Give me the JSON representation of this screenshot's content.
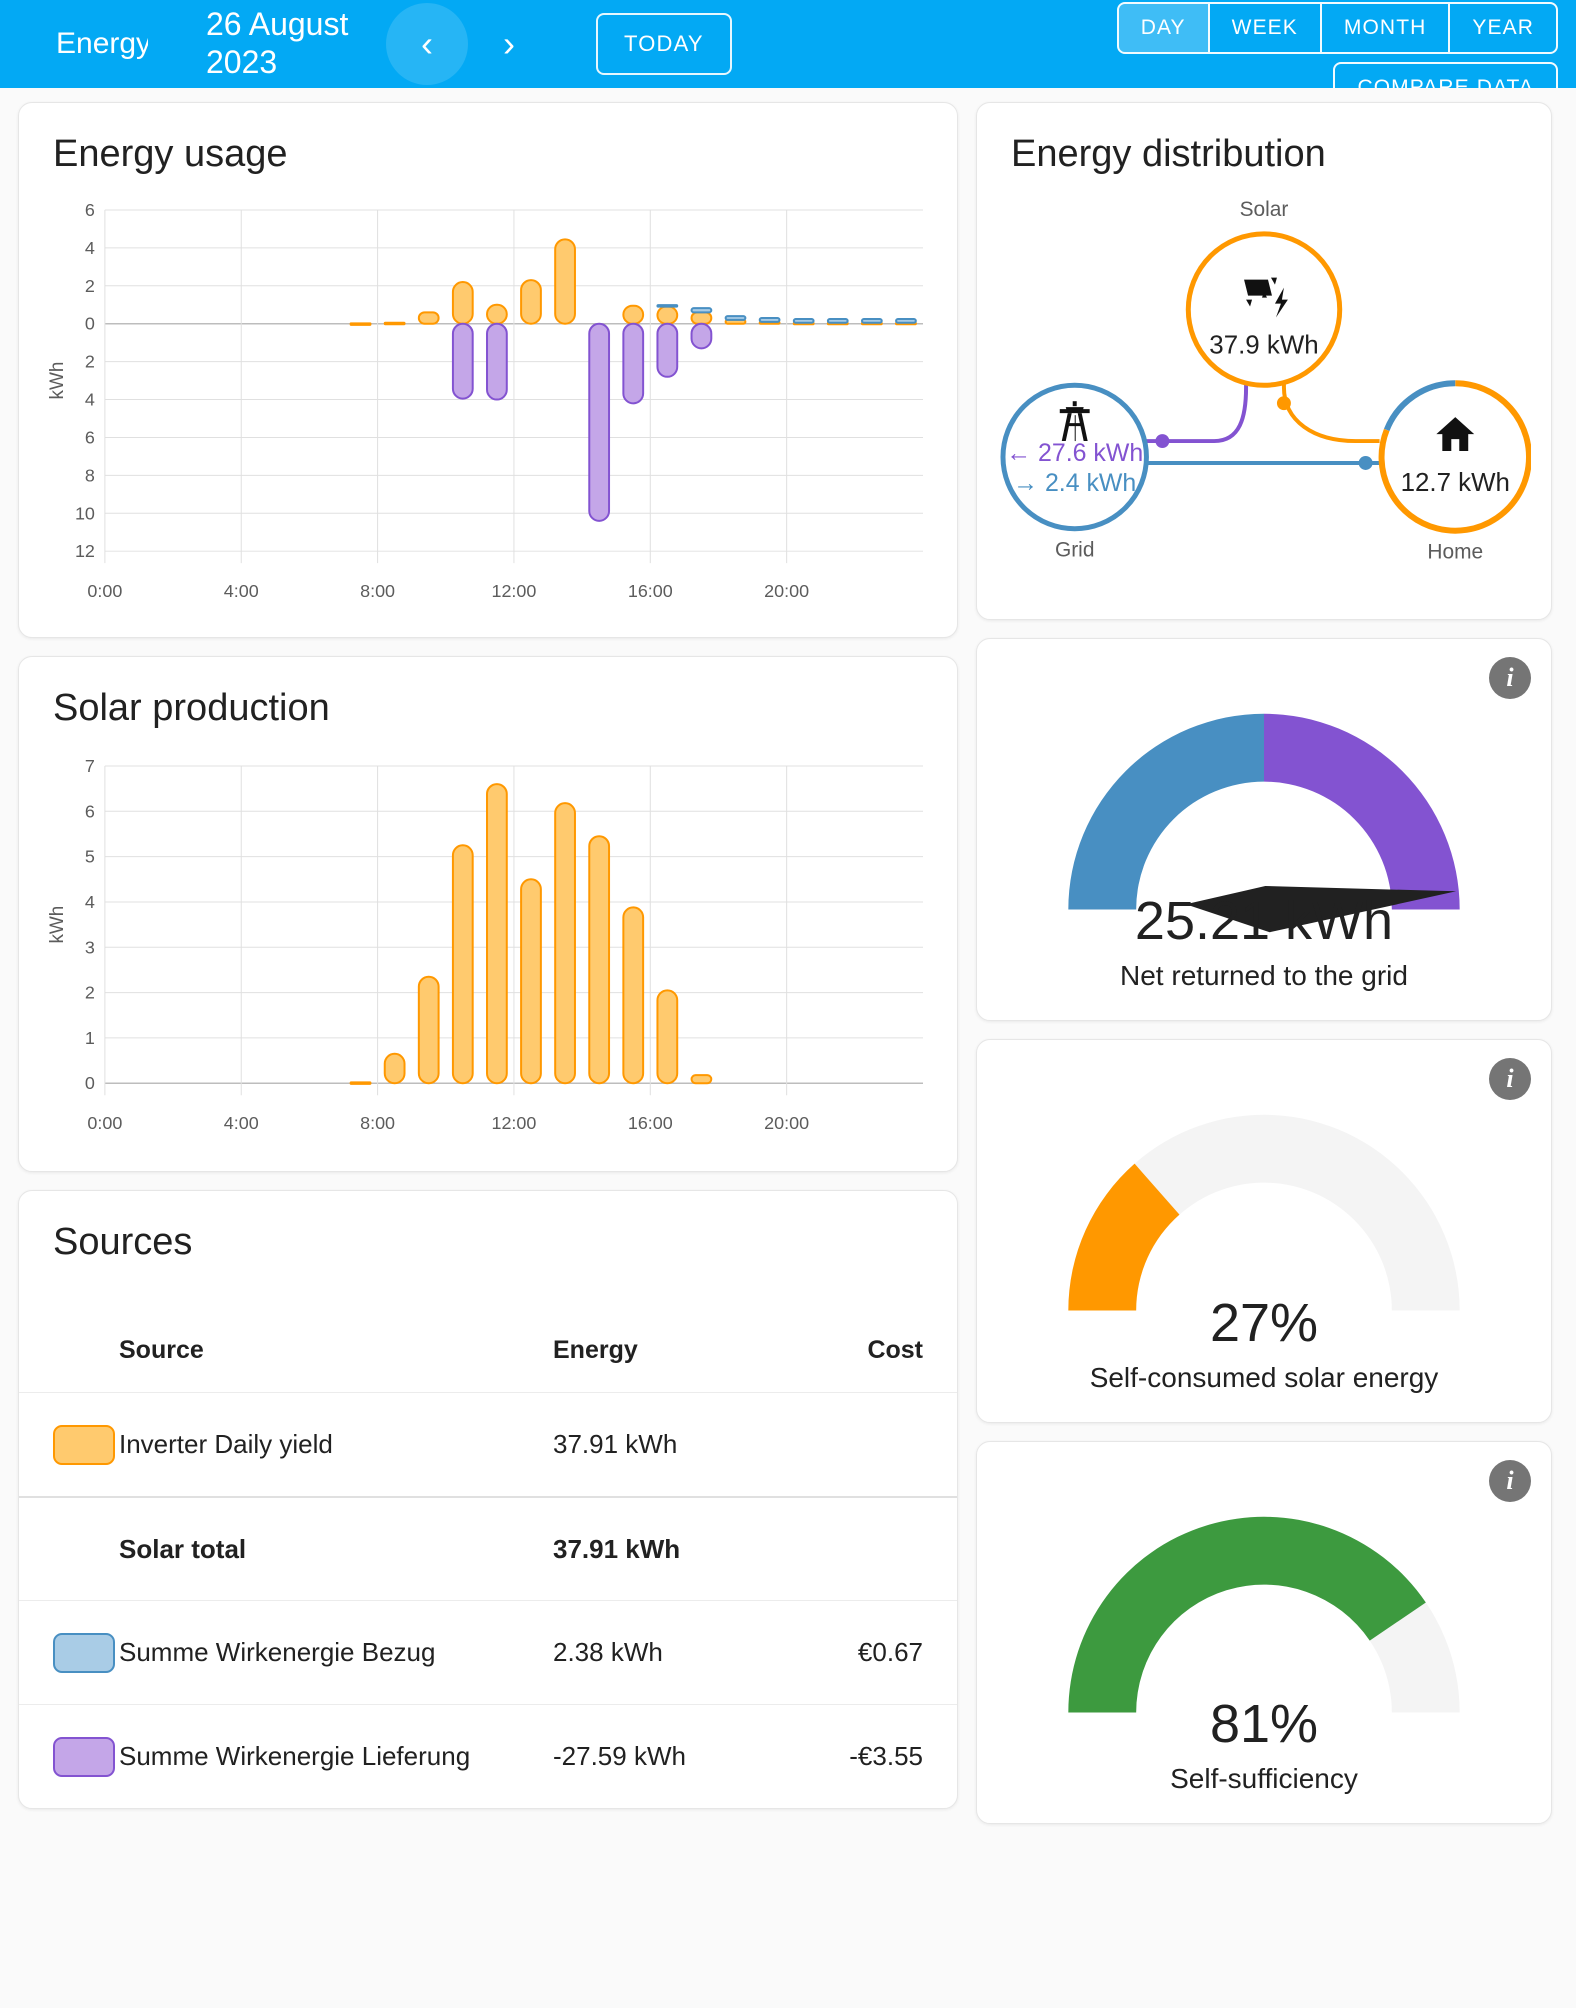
{
  "header": {
    "app_title": "Energy",
    "date": "26 August 2023",
    "prev_label": "‹",
    "next_label": "›",
    "today_label": "TODAY",
    "periods": [
      {
        "label": "DAY",
        "selected": true
      },
      {
        "label": "WEEK",
        "selected": false
      },
      {
        "label": "MONTH",
        "selected": false
      },
      {
        "label": "YEAR",
        "selected": false
      }
    ],
    "compare_label": "COMPARE DATA",
    "bar_color": "#03a9f4"
  },
  "cards": {
    "energy_usage_title": "Energy usage",
    "solar_production_title": "Solar production",
    "sources_title": "Sources",
    "distribution_title": "Energy distribution"
  },
  "distribution": {
    "solar_label": "Solar",
    "solar_value": "37.9 kWh",
    "grid_label": "Grid",
    "grid_in": "← 27.6 kWh",
    "grid_out": "→ 2.4 kWh",
    "home_label": "Home",
    "home_value": "12.7 kWh",
    "solar_color": "#ff9800",
    "grid_color": "#488fc2",
    "return_color": "#8353d1",
    "home_solar_fraction": 0.81,
    "solar_icon": "solar-panel-icon",
    "grid_icon": "transmission-tower-icon",
    "home_icon": "home-icon"
  },
  "gauges": [
    {
      "value": "25.21 kWh",
      "caption": "Net returned to the grid",
      "type": "needle",
      "needle_fraction": 0.97,
      "left_color": "#488fc2",
      "right_color": "#8353d1",
      "split": 0.5,
      "info_label": "i"
    },
    {
      "value": "27%",
      "caption": "Self-consumed solar energy",
      "type": "arc",
      "fraction": 0.27,
      "color": "#ff9800",
      "track_color": "#f4f4f4",
      "info_label": "i"
    },
    {
      "value": "81%",
      "caption": "Self-sufficiency",
      "type": "arc",
      "fraction": 0.81,
      "color": "#3d9a3f",
      "track_color": "#f4f4f4",
      "info_label": "i"
    }
  ],
  "sources": {
    "columns": [
      "Source",
      "Energy",
      "Cost"
    ],
    "rows": [
      {
        "name": "Inverter Daily yield",
        "energy": "37.91 kWh",
        "cost": "",
        "swatch_fill": "#ffca6e",
        "swatch_stroke": "#ff9800",
        "kind": "item"
      },
      {
        "name": "Solar total",
        "energy": "37.91 kWh",
        "cost": "",
        "swatch_fill": "",
        "swatch_stroke": "",
        "kind": "total"
      },
      {
        "name": "Summe Wirkenergie Bezug",
        "energy": "2.38 kWh",
        "cost": "€0.67",
        "swatch_fill": "#a9cce6",
        "swatch_stroke": "#488fc2",
        "kind": "item"
      },
      {
        "name": "Summe Wirkenergie Lieferung",
        "energy": "-27.59 kWh",
        "cost": "-€3.55",
        "swatch_fill": "#c4a6e8",
        "swatch_stroke": "#8353d1",
        "kind": "item"
      }
    ]
  },
  "chart_data": [
    {
      "type": "bar",
      "id": "energy-usage",
      "title": "Energy usage",
      "xlabel": "",
      "ylabel": "kWh",
      "x_ticks": [
        "0:00",
        "4:00",
        "8:00",
        "12:00",
        "16:00",
        "20:00"
      ],
      "x_tick_hours": [
        0,
        4,
        8,
        12,
        16,
        20
      ],
      "y_ticks": [
        "6",
        "4",
        "2",
        "0",
        "2",
        "4",
        "6",
        "8",
        "10",
        "12"
      ],
      "y_tick_values": [
        6,
        4,
        2,
        0,
        -2,
        -4,
        -6,
        -8,
        -10,
        -12
      ],
      "ylim": [
        -12,
        6
      ],
      "xlim": [
        0,
        24
      ],
      "grid": true,
      "stacked": true,
      "hours": [
        0,
        1,
        2,
        3,
        4,
        5,
        6,
        7,
        8,
        9,
        10,
        11,
        12,
        13,
        14,
        15,
        16,
        17,
        18,
        19,
        20,
        21,
        22,
        23
      ],
      "series": [
        {
          "name": "Solar",
          "color": "#ffca6e",
          "stroke": "#ff9800",
          "values": [
            0,
            0,
            0,
            0,
            0,
            0,
            0,
            0.02,
            0.05,
            0.6,
            2.2,
            1.0,
            2.3,
            4.45,
            0,
            0.95,
            0.9,
            0.6,
            0.2,
            0.1,
            0.05,
            0.05,
            0.05,
            0.05
          ]
        },
        {
          "name": "Summe Wirkenergie Bezug",
          "color": "#a9cce6",
          "stroke": "#488fc2",
          "values": [
            0,
            0,
            0,
            0,
            0,
            0,
            0,
            0,
            0,
            0,
            0,
            0,
            0,
            0,
            0,
            0,
            0.08,
            0.22,
            0.2,
            0.2,
            0.2,
            0.2,
            0.2,
            0.2
          ]
        },
        {
          "name": "Summe Wirkenergie Lieferung",
          "color": "#c4a6e8",
          "stroke": "#8353d1",
          "values": [
            0,
            0,
            0,
            0,
            0,
            0,
            0,
            0,
            0,
            0,
            -3.95,
            -4.0,
            0,
            0,
            -10.4,
            -4.2,
            -2.8,
            -1.3,
            0,
            0,
            0,
            0,
            0,
            0
          ]
        }
      ]
    },
    {
      "type": "bar",
      "id": "solar-production",
      "title": "Solar production",
      "xlabel": "",
      "ylabel": "kWh",
      "x_ticks": [
        "0:00",
        "4:00",
        "8:00",
        "12:00",
        "16:00",
        "20:00"
      ],
      "x_tick_hours": [
        0,
        4,
        8,
        12,
        16,
        20
      ],
      "y_ticks": [
        "0",
        "1",
        "2",
        "3",
        "4",
        "5",
        "6",
        "7"
      ],
      "y_tick_values": [
        0,
        1,
        2,
        3,
        4,
        5,
        6,
        7
      ],
      "ylim": [
        0,
        7
      ],
      "xlim": [
        0,
        24
      ],
      "grid": true,
      "color": "#ffca6e",
      "stroke": "#ff9800",
      "hours": [
        0,
        1,
        2,
        3,
        4,
        5,
        6,
        7,
        8,
        9,
        10,
        11,
        12,
        13,
        14,
        15,
        16,
        17,
        18,
        19,
        20,
        21,
        22,
        23
      ],
      "values": [
        0,
        0,
        0,
        0,
        0,
        0,
        0,
        0.02,
        0.65,
        2.35,
        5.25,
        6.6,
        4.5,
        6.18,
        5.45,
        3.88,
        2.05,
        0.18,
        0,
        0,
        0,
        0,
        0,
        0
      ]
    }
  ]
}
